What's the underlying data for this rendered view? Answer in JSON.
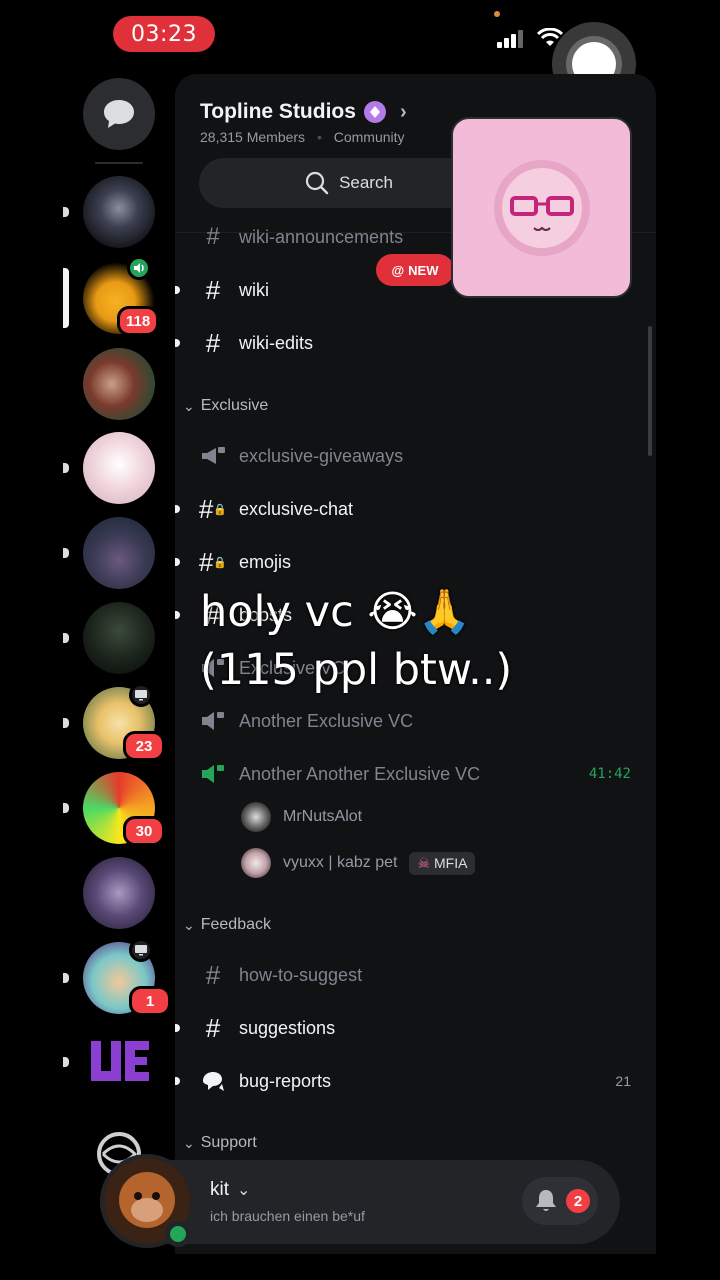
{
  "status_bar": {
    "time": "03:23"
  },
  "server": {
    "name": "Topline Studios",
    "members": "28,315 Members",
    "separator": "•",
    "type": "Community"
  },
  "search": {
    "label": "Search"
  },
  "new_pill": {
    "label": "NEW"
  },
  "rail_badges": {
    "s1": "118",
    "s6": "23",
    "s7": "30",
    "s9": "1"
  },
  "channels": {
    "wiki_announcements": "wiki-announcements",
    "wiki": "wiki",
    "wiki_edits": "wiki-edits",
    "cat_exclusive": "Exclusive",
    "exclusive_giveaways": "exclusive-giveaways",
    "exclusive_chat": "exclusive-chat",
    "emojis": "emojis",
    "boosts": "boosts",
    "exclusive_vc": "Exclusive VC",
    "another_exclusive_vc": "Another Exclusive VC",
    "another_another_exclusive_vc": "Another Another Exclusive VC",
    "vc_timer": "41:42",
    "cat_feedback": "Feedback",
    "how_to_suggest": "how-to-suggest",
    "suggestions": "suggestions",
    "bug_reports": "bug-reports",
    "bug_reports_count": "21",
    "cat_support": "Support"
  },
  "vc_users": [
    {
      "name": "MrNutsAlot"
    },
    {
      "name": "vyuxx | kabz pet",
      "tag": "MFIA"
    }
  ],
  "caption": {
    "line1": "holy vc 😭🙏",
    "line2": "(115 ppl btw..)"
  },
  "user": {
    "name": "kit",
    "status": "ich brauchen einen be*uf"
  },
  "notifications": {
    "count": "2"
  },
  "colors": {
    "accent_red": "#e0313b",
    "online_green": "#23a55a",
    "panel_bg": "#111214",
    "voice_green": "#23a55a"
  }
}
